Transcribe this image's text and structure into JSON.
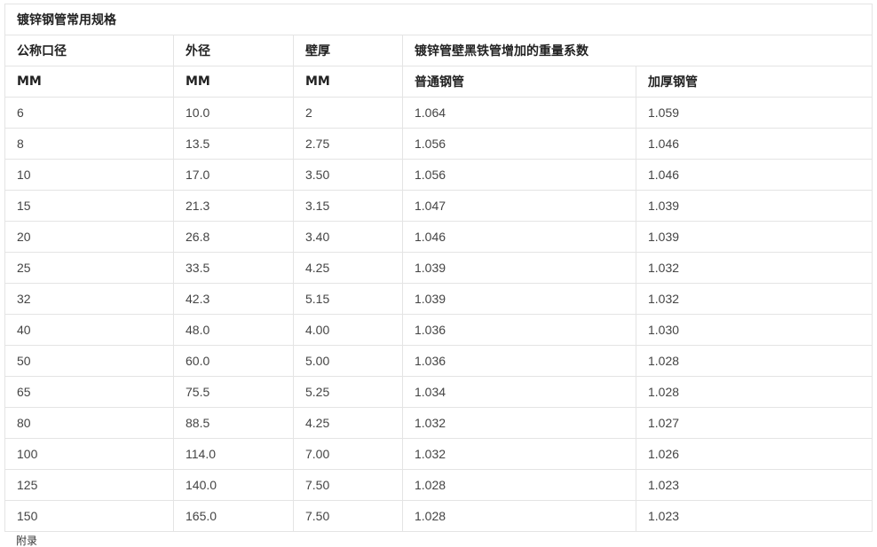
{
  "table": {
    "title": "镀锌钢管常用规格",
    "header1": [
      "公称口径",
      "外径",
      "壁厚",
      "镀锌管壁黑铁管增加的重量系数"
    ],
    "header2": [
      "MM",
      "MM",
      "MM",
      "普通钢管",
      "加厚钢管"
    ],
    "rows": [
      [
        "6",
        "10.0",
        "2",
        "1.064",
        "1.059"
      ],
      [
        "8",
        "13.5",
        "2.75",
        "1.056",
        "1.046"
      ],
      [
        "10",
        "17.0",
        "3.50",
        "1.056",
        "1.046"
      ],
      [
        "15",
        "21.3",
        "3.15",
        "1.047",
        "1.039"
      ],
      [
        "20",
        "26.8",
        "3.40",
        "1.046",
        "1.039"
      ],
      [
        "25",
        "33.5",
        "4.25",
        "1.039",
        "1.032"
      ],
      [
        "32",
        "42.3",
        "5.15",
        "1.039",
        "1.032"
      ],
      [
        "40",
        "48.0",
        "4.00",
        "1.036",
        "1.030"
      ],
      [
        "50",
        "60.0",
        "5.00",
        "1.036",
        "1.028"
      ],
      [
        "65",
        "75.5",
        "5.25",
        "1.034",
        "1.028"
      ],
      [
        "80",
        "88.5",
        "4.25",
        "1.032",
        "1.027"
      ],
      [
        "100",
        "114.0",
        "7.00",
        "1.032",
        "1.026"
      ],
      [
        "125",
        "140.0",
        "7.50",
        "1.028",
        "1.023"
      ],
      [
        "150",
        "165.0",
        "7.50",
        "1.028",
        "1.023"
      ]
    ]
  },
  "note": "附录"
}
